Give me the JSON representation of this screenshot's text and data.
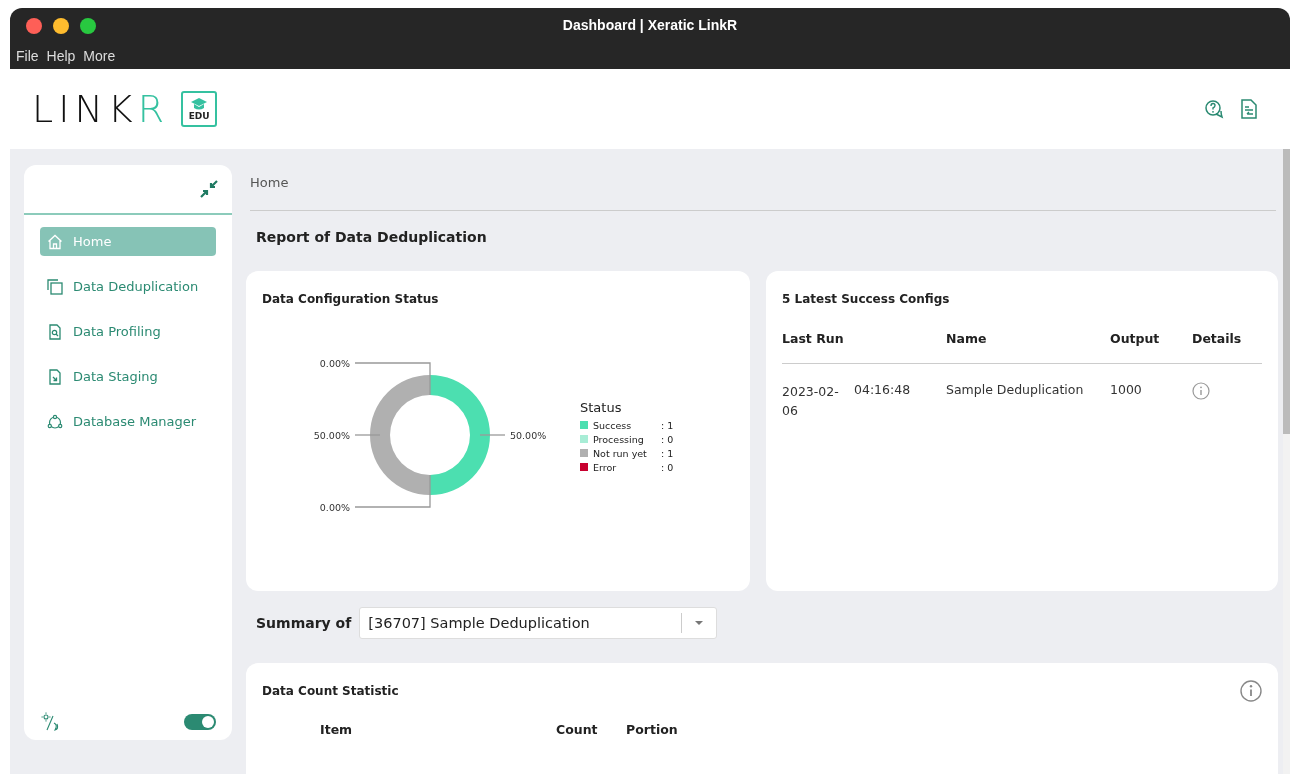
{
  "window": {
    "title": "Dashboard | Xeratic LinkR"
  },
  "menu": [
    "File",
    "Help",
    "More"
  ],
  "logo": {
    "text": "LINK",
    "accent": "R",
    "badge": "EDU"
  },
  "sidebar": {
    "items": [
      {
        "label": "Home",
        "selected": true
      },
      {
        "label": "Data Deduplication",
        "selected": false
      },
      {
        "label": "Data Profiling",
        "selected": false
      },
      {
        "label": "Data Staging",
        "selected": false
      },
      {
        "label": "Database Manager",
        "selected": false
      }
    ],
    "dark_mode_toggle": {
      "on": true
    }
  },
  "breadcrumb": "Home",
  "page_title": "Report of Data Deduplication",
  "status_card": {
    "title": "Data Configuration Status",
    "chart_data": {
      "type": "donut",
      "categories": [
        "Success",
        "Processing",
        "Not run yet",
        "Error"
      ],
      "series": [
        {
          "name": "Status",
          "values": [
            50,
            0,
            50,
            0
          ]
        }
      ],
      "value_labels": [
        "50.00%",
        "0.00%",
        "50.00%",
        "0.00%"
      ]
    },
    "legend": {
      "items": [
        {
          "count": ": 1",
          "color": "#4cdfb0"
        },
        {
          "count": ": 0",
          "color": "#a8edd6"
        },
        {
          "count": ": 1",
          "color": "#b0b0b0"
        },
        {
          "count": ": 0",
          "color": "#c8002f"
        }
      ]
    }
  },
  "configs_card": {
    "title": "5 Latest Success Configs",
    "columns": [
      "Last Run",
      "Name",
      "Output",
      "Details"
    ],
    "rows": [
      {
        "date": "2023-02-06",
        "time": "04:16:48",
        "name": "Sample Deduplication",
        "output": "1000"
      }
    ]
  },
  "summary": {
    "label": "Summary of",
    "value": "[36707] Sample Deduplication"
  },
  "count_card": {
    "title": "Data Count Statistic",
    "columns": [
      "Item",
      "Count",
      "Portion"
    ]
  }
}
